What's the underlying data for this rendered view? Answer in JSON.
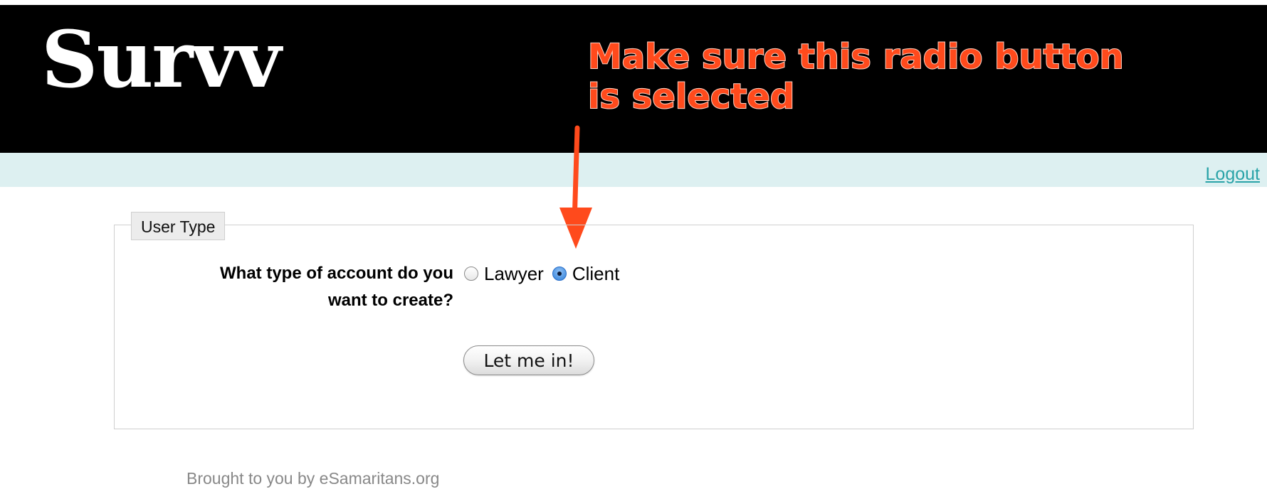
{
  "header": {
    "logo_text": "Survv",
    "background": "#000000"
  },
  "annotation": {
    "line1": "Make sure this radio button",
    "line2": "is selected",
    "color": "#ff4a1c",
    "arrow_icon": "down-arrow-icon"
  },
  "nav": {
    "logout_label": "Logout",
    "bar_color": "#ddf0f1",
    "link_color": "#2aa3a8"
  },
  "form": {
    "legend": "User Type",
    "question_line1": "What type of account do you",
    "question_line2": "want to create?",
    "options": [
      {
        "label": "Lawyer",
        "checked": false
      },
      {
        "label": "Client",
        "checked": true
      }
    ],
    "submit_label": "Let me in!"
  },
  "footer": {
    "text": "Brought to you by eSamaritans.org"
  }
}
